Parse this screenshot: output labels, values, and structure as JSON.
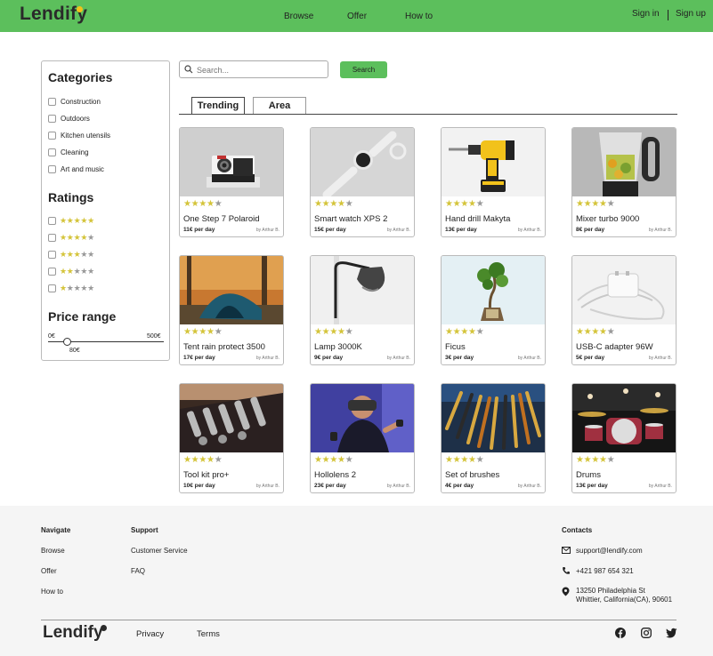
{
  "header": {
    "logo": "Lendify",
    "nav": [
      "Browse",
      "Offer",
      "How to"
    ],
    "sign_in": "Sign in",
    "sign_up": "Sign up",
    "colors": {
      "bar": "#5cbf5c",
      "logo_dot": "#f2c21b"
    }
  },
  "sidebar": {
    "categories_title": "Categories",
    "categories": [
      "Construction",
      "Outdoors",
      "Kitchen utensils",
      "Cleaning",
      "Art and music"
    ],
    "ratings_title": "Ratings",
    "ratings": [
      5,
      4,
      3,
      2,
      1
    ],
    "price_title": "Price range",
    "price_min": "0€",
    "price_max": "500€",
    "price_value": "80€",
    "price_fraction": 0.16
  },
  "search": {
    "placeholder": "Search...",
    "button": "Search"
  },
  "tabs": [
    "Trending",
    "Area"
  ],
  "products": [
    {
      "title": "One Step 7 Polaroid",
      "price": "11€ per day",
      "by": "by Arthur B.",
      "rating": 4,
      "image": "polaroid-camera"
    },
    {
      "title": "Smart watch XPS 2",
      "price": "15€ per day",
      "by": "by Arthur B.",
      "rating": 4,
      "image": "smart-watch"
    },
    {
      "title": "Hand drill Makyta",
      "price": "13€ per day",
      "by": "by Arthur B.",
      "rating": 4,
      "image": "hand-drill"
    },
    {
      "title": "Mixer turbo 9000",
      "price": "8€ per day",
      "by": "by Arthur B.",
      "rating": 4,
      "image": "mixer"
    },
    {
      "title": "Tent rain protect 3500",
      "price": "17€ per day",
      "by": "by Arthur B.",
      "rating": 4,
      "image": "tent"
    },
    {
      "title": "Lamp 3000K",
      "price": "9€ per day",
      "by": "by Arthur B.",
      "rating": 4,
      "image": "lamp"
    },
    {
      "title": "Ficus",
      "price": "3€ per day",
      "by": "by Arthur B.",
      "rating": 4,
      "image": "ficus"
    },
    {
      "title": "USB-C adapter 96W",
      "price": "5€ per day",
      "by": "by Arthur B.",
      "rating": 4,
      "image": "usb-adapter"
    },
    {
      "title": "Tool kit pro+",
      "price": "10€ per day",
      "by": "by Arthur B.",
      "rating": 4,
      "image": "tool-kit"
    },
    {
      "title": "Hollolens 2",
      "price": "23€ per day",
      "by": "by Arthur B.",
      "rating": 4,
      "image": "vr-headset"
    },
    {
      "title": "Set of brushes",
      "price": "4€ per day",
      "by": "by Arthur B.",
      "rating": 4,
      "image": "brushes"
    },
    {
      "title": "Drums",
      "price": "13€ per day",
      "by": "by Arthur B.",
      "rating": 4,
      "image": "drums"
    }
  ],
  "footer": {
    "navigate_title": "Navigate",
    "navigate": [
      "Browse",
      "Offer",
      "How to"
    ],
    "support_title": "Support",
    "support": [
      "Customer Service",
      "FAQ"
    ],
    "contacts_title": "Contacts",
    "email": "support@lendify.com",
    "phone": "+421 987 654 321",
    "address_line1": "13250 Philadelphia St",
    "address_line2": "Whittier, California(CA), 90601",
    "logo": "Lendify",
    "links": [
      "Privacy",
      "Terms"
    ],
    "social": [
      "facebook-icon",
      "instagram-icon",
      "twitter-icon"
    ]
  }
}
